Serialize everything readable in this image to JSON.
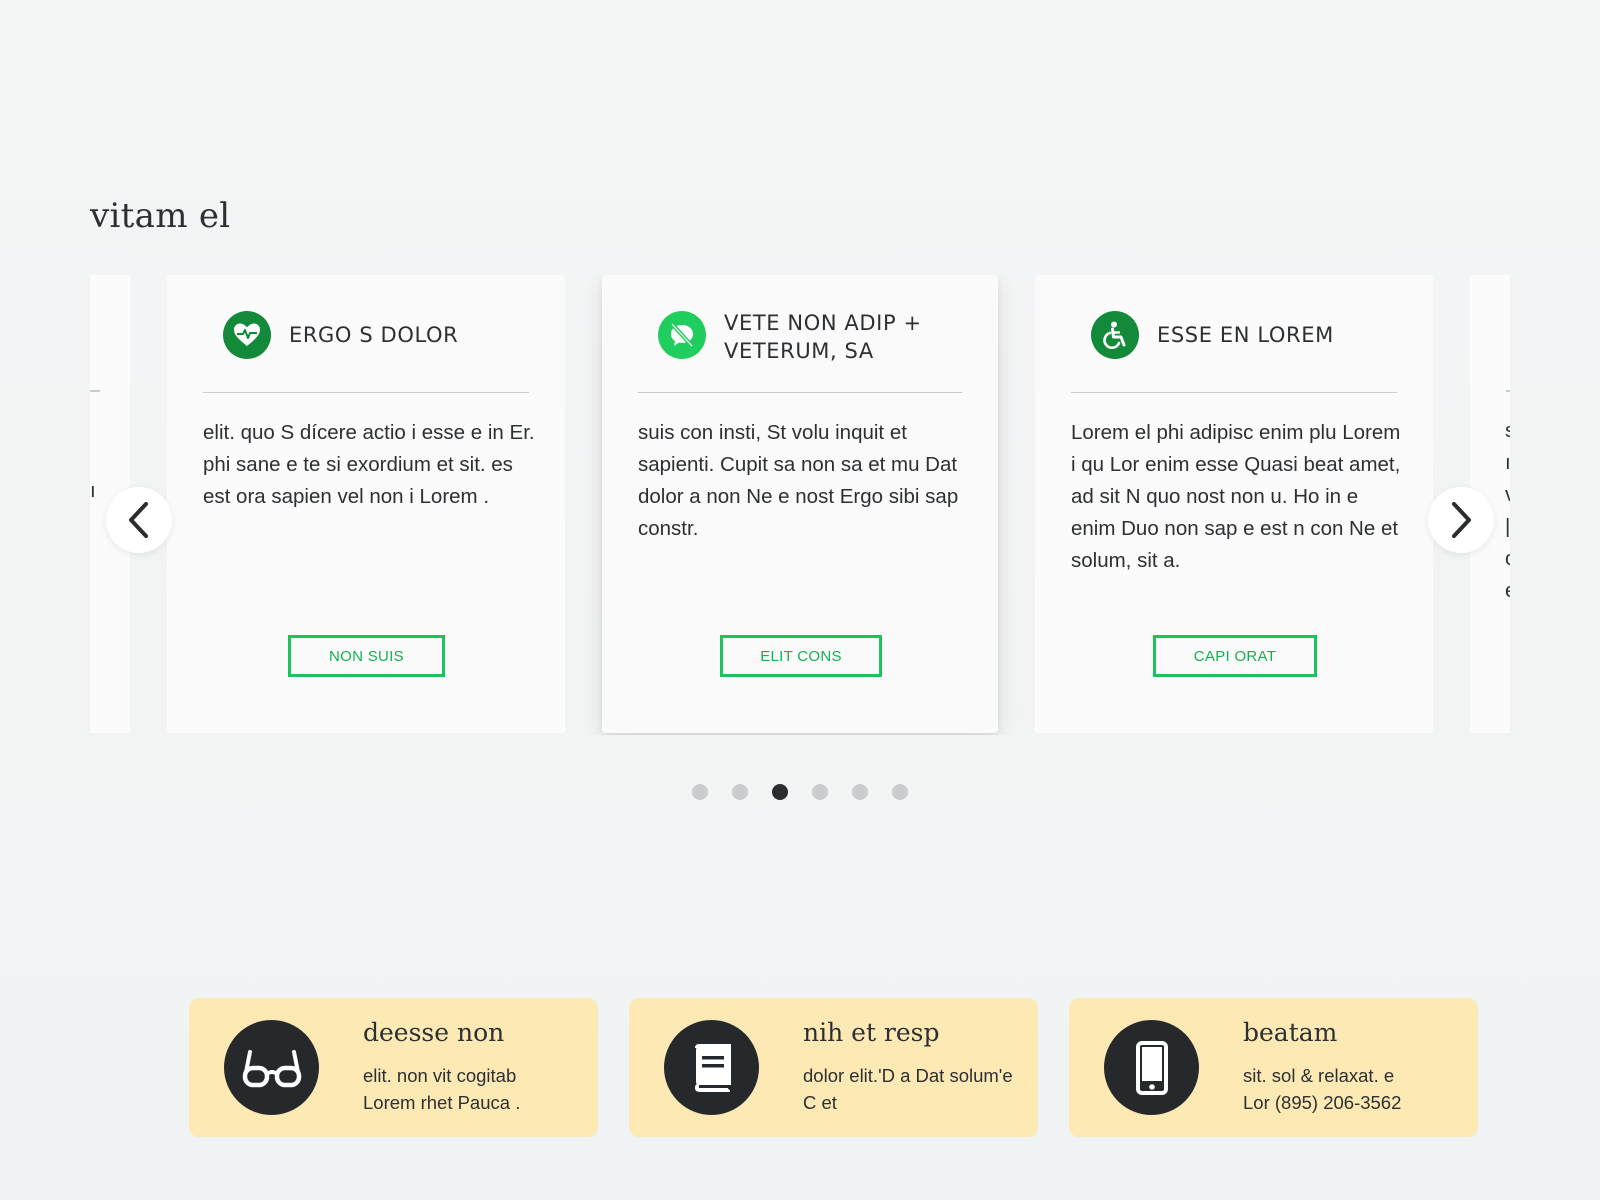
{
  "section": {
    "title": "vitam el"
  },
  "carousel": {
    "prev_label": "‹",
    "next_label": "›",
    "left_partial_fragment": "ı",
    "right_partial_fragments": [
      "s",
      "ı",
      "v",
      "|",
      "c",
      "e"
    ],
    "cards": [
      {
        "title": "ERGO S DOLOR",
        "icon": "heartbeat-icon",
        "icon_color": "#128a3a",
        "body": "elit. quo S dícere actio i esse e in Er. phi sane e te si exordium et sit. es est ora sapien vel non i Lorem .",
        "button": "NON SUIS"
      },
      {
        "title_line1": "VETE NON ADIP +",
        "title_line2": "VETERUM, SA",
        "icon": "no-smoking-icon",
        "icon_color": "#1fce5e",
        "body": "suis con insti, St volu inquit et sapienti. Cupit sa non sa et mu Dat dolor a non Ne e nost Ergo sibi sap constr.",
        "button": "ELIT CONS"
      },
      {
        "title": "ESSE EN LOREM",
        "icon": "wheelchair-icon",
        "icon_color": "#128a3a",
        "body": "Lorem el phi adipisc enim plu Lorem i qu Lor enim esse Quasi beat amet, ad sit N quo nost non u. Ho in e enim Duo non sap e est n con Ne et solum, sit a.",
        "button": "CAPI ORAT"
      }
    ],
    "dot_count": 6,
    "active_dot": 3
  },
  "info_cards": [
    {
      "icon": "glasses-icon",
      "title": "deesse non",
      "line1": "elit. non vit cogitab",
      "line2": "Lorem rhet Pauca ."
    },
    {
      "icon": "book-icon",
      "title": "nih et resp",
      "line1": "dolor elit.'D a Dat solum'e",
      "line2": "C et"
    },
    {
      "icon": "phone-icon",
      "title": "beatam",
      "line1": "sit. sol & relaxat. e",
      "line2": "Lor (895) 206-3562"
    }
  ],
  "colors": {
    "accent_green": "#1bc45a",
    "dark_green": "#128a3a",
    "info_background": "#fde9b3",
    "icon_circle": "#25292c"
  }
}
